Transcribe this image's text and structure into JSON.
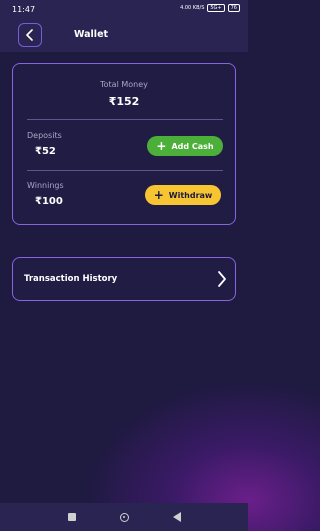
{
  "status_bar": {
    "time": "11:47",
    "network_label": "4.00 KB/S",
    "signal_label": "5G+",
    "battery": "76"
  },
  "header": {
    "title": "Wallet"
  },
  "wallet": {
    "total_label": "Total Money",
    "total_value": "₹152",
    "deposits_label": "Deposits",
    "deposits_value": "₹52",
    "add_cash_label": "Add Cash",
    "winnings_label": "Winnings",
    "winnings_value": "₹100",
    "withdraw_label": "Withdraw"
  },
  "history": {
    "label": "Transaction History"
  },
  "colors": {
    "background": "#1e1a40",
    "card_border": "#8a63e0",
    "add_cash": "#4caf3a",
    "withdraw": "#f7c531"
  },
  "icons": {
    "back": "chevron-left-icon",
    "history": "chevron-right-icon",
    "plus": "plus-icon"
  }
}
